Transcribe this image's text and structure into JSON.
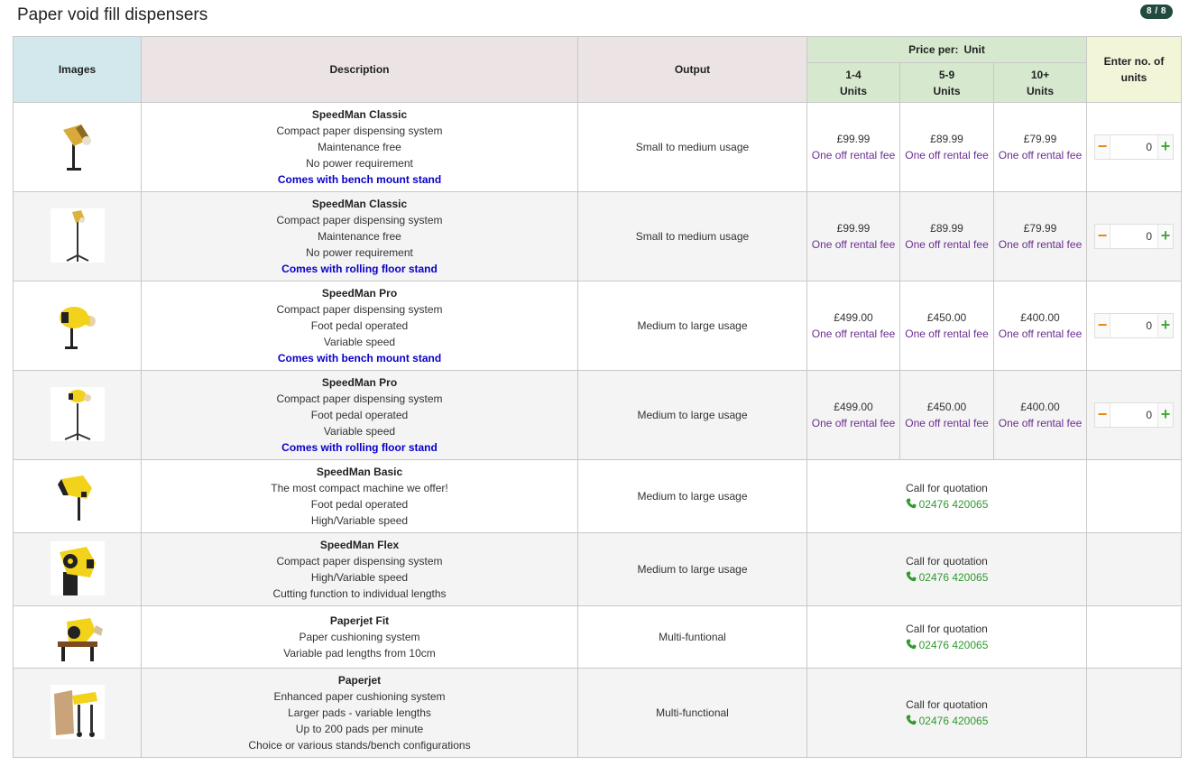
{
  "page": {
    "title": "Paper void fill dispensers",
    "badge": "8 / 8"
  },
  "headers": {
    "images": "Images",
    "description": "Description",
    "output": "Output",
    "price_per": "Price per:",
    "price_unit": "Unit",
    "tiers": [
      "1-4",
      "5-9",
      "10+"
    ],
    "tier_unit": "Units",
    "qty": "Enter no. of units"
  },
  "image_icons": [
    "speedman-classic-bench-image",
    "speedman-classic-floor-image",
    "speedman-pro-bench-image",
    "speedman-pro-floor-image",
    "speedman-basic-image",
    "speedman-flex-image",
    "paperjet-fit-image",
    "paperjet-image"
  ],
  "colors": {
    "stand_text": "#0a00c8",
    "rental_text": "#6b2f8f",
    "phone_text": "#2f9a2f",
    "minus": "#e88a0e",
    "plus": "#49a73e"
  },
  "rows": [
    {
      "title": "SpeedMan Classic",
      "lines": [
        "Compact paper dispensing system",
        "Maintenance free",
        "No power requirement"
      ],
      "stand": "Comes with bench mount stand",
      "output": "Small to medium usage",
      "prices": [
        "£99.99",
        "£89.99",
        "£79.99"
      ],
      "rental": "One off rental fee",
      "qty": "0"
    },
    {
      "title": "SpeedMan Classic",
      "lines": [
        "Compact paper dispensing system",
        "Maintenance free",
        "No power requirement"
      ],
      "stand": "Comes with rolling floor stand",
      "output": "Small to medium usage",
      "prices": [
        "£99.99",
        "£89.99",
        "£79.99"
      ],
      "rental": "One off rental fee",
      "qty": "0"
    },
    {
      "title": "SpeedMan Pro",
      "lines": [
        "Compact paper dispensing system",
        "Foot pedal operated",
        "Variable speed"
      ],
      "stand": "Comes with bench mount stand",
      "output": "Medium to large usage",
      "prices": [
        "£499.00",
        "£450.00",
        "£400.00"
      ],
      "rental": "One off rental fee",
      "qty": "0"
    },
    {
      "title": "SpeedMan Pro",
      "lines": [
        "Compact paper dispensing system",
        "Foot pedal operated",
        "Variable speed"
      ],
      "stand": "Comes with rolling floor stand",
      "output": "Medium to large usage",
      "prices": [
        "£499.00",
        "£450.00",
        "£400.00"
      ],
      "rental": "One off rental fee",
      "qty": "0"
    },
    {
      "title": "SpeedMan Basic",
      "lines": [
        "The most compact machine we offer!",
        "Foot pedal operated",
        "High/Variable speed"
      ],
      "output": "Medium to large usage",
      "call": "Call for quotation",
      "phone": "02476 420065"
    },
    {
      "title": "SpeedMan Flex",
      "lines": [
        "Compact paper dispensing system",
        "High/Variable speed",
        "Cutting function to individual lengths"
      ],
      "output": "Medium to large usage",
      "call": "Call for quotation",
      "phone": "02476 420065"
    },
    {
      "title": "Paperjet Fit",
      "lines": [
        "Paper cushioning system",
        "Variable pad lengths from 10cm"
      ],
      "output": "Multi-funtional",
      "call": "Call for quotation",
      "phone": "02476 420065"
    },
    {
      "title": "Paperjet",
      "lines": [
        "Enhanced paper cushioning system",
        "Larger pads - variable lengths",
        "Up to 200 pads per minute",
        "Choice or various stands/bench configurations"
      ],
      "output": "Multi-functional",
      "call": "Call for quotation",
      "phone": "02476 420065"
    }
  ]
}
